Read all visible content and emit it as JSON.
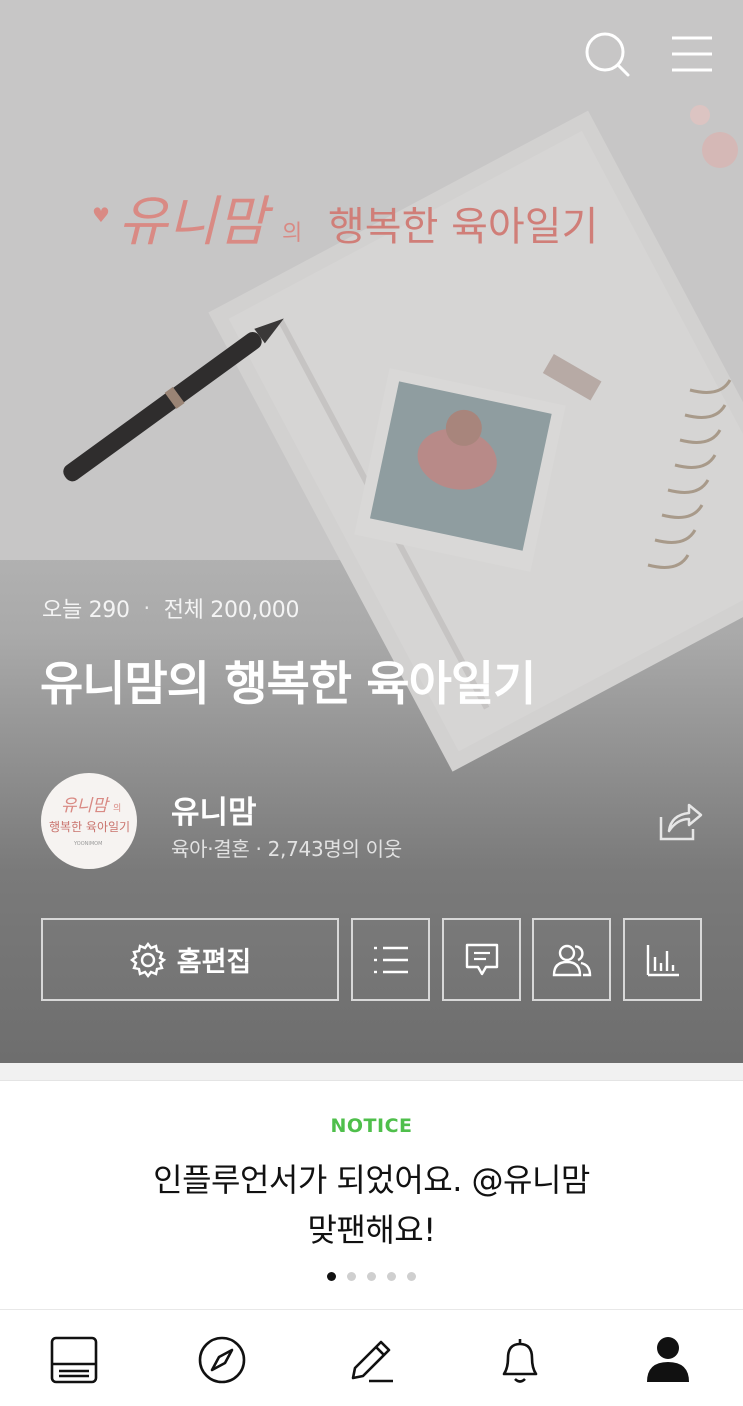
{
  "hero": {
    "banner_title_pink": "유니맘",
    "banner_title_small": "의",
    "banner_title_rest": "행복한 육아일기",
    "stats": {
      "today_label": "오늘 290",
      "total_label": "전체 200,000"
    },
    "title": "유니맘의 행복한 육아일기",
    "profile": {
      "nickname": "유니맘",
      "meta": "육아·결혼 · 2,743명의 이웃",
      "avatar_text_top": "유니맘",
      "avatar_text_small": "의",
      "avatar_text_mid": "행복한 육아일기",
      "avatar_text_bottom": "YOONIMOM"
    },
    "edit_button_label": "홈편집"
  },
  "notice": {
    "label": "NOTICE",
    "line1": "인플루언서가 되었어요. @유니맘",
    "line2": "맞팬해요!",
    "pages": 5,
    "active_page": 1
  },
  "colors": {
    "notice_label": "#4fbf4b",
    "banner_pink": "#d98a84"
  }
}
